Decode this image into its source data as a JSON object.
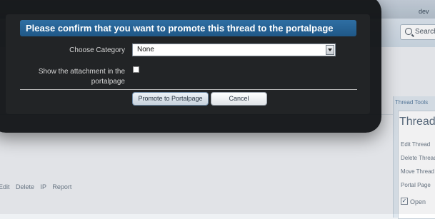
{
  "background": {
    "user_link": "dev",
    "search_label": "Search",
    "post_links": "Edit Delete IP Report",
    "thread_tools_header": "Thread Tools",
    "sidebar_title": "Thread",
    "sidebar_items": [
      "Edit Thread",
      "Delete Thread",
      "Move Thread",
      "Portal Page"
    ],
    "open_label": "Open",
    "open_checked": "✓"
  },
  "dialog": {
    "title": "Please confirm that you want to promote this thread to the portalpage",
    "category_label": "Choose Category",
    "category_value": "None",
    "attachment_label": "Show the attachment in the portalpage",
    "attachment_checked": false,
    "promote_button": "Promote to Portalpage",
    "cancel_button": "Cancel"
  },
  "colors": {
    "title_bar": "#2a6698",
    "modal_bg": "#222426",
    "label_text": "#d6d6d6"
  }
}
